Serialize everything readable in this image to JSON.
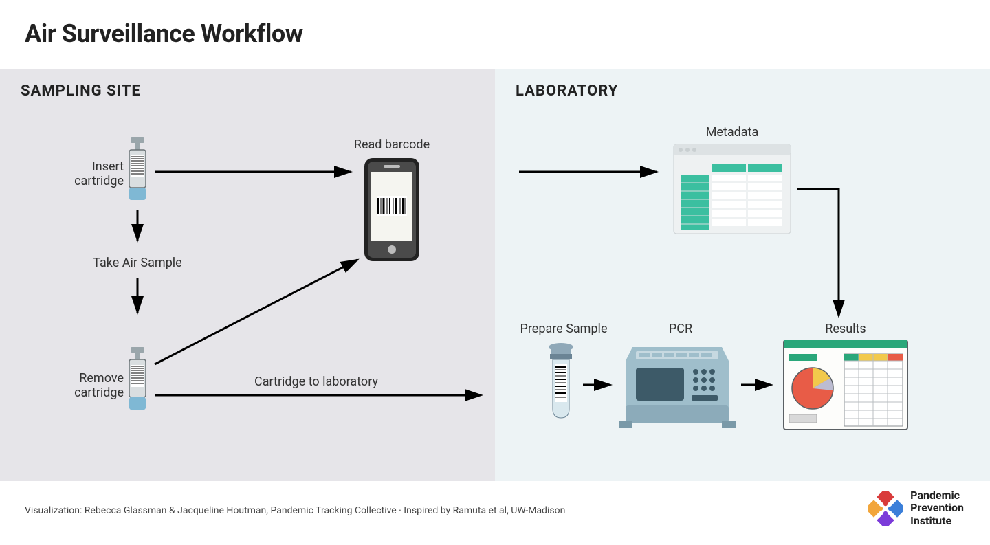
{
  "title": "Air Surveillance Workflow",
  "sections": {
    "left": "SAMPLING SITE",
    "right": "LABORATORY"
  },
  "steps": {
    "insert_cartridge": "Insert\ncartridge",
    "take_air_sample": "Take Air Sample",
    "remove_cartridge": "Remove\ncartridge",
    "read_barcode": "Read barcode",
    "cartridge_to_lab": "Cartridge to laboratory",
    "metadata": "Metadata",
    "prepare_sample": "Prepare Sample",
    "pcr": "PCR",
    "results": "Results"
  },
  "credit": "Visualization: Rebecca Glassman & Jacqueline Houtman, Pandemic Tracking Collective · Inspired by Ramuta et al, UW-Madison",
  "brand": "Pandemic\nPrevention\nInstitute"
}
